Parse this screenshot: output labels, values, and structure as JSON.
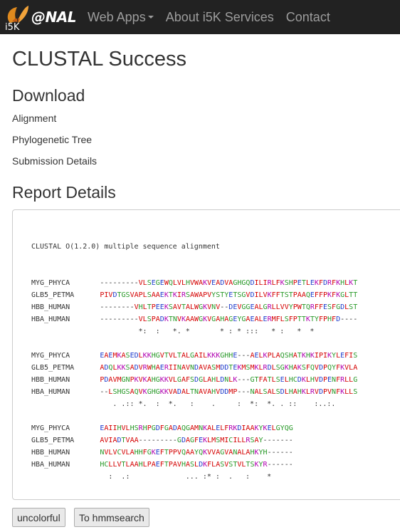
{
  "navbar": {
    "brand_prefix": "i5K",
    "brand_name": "@NAL",
    "items": [
      {
        "label": "Web Apps",
        "dropdown": true
      },
      {
        "label": "About i5K Services",
        "dropdown": false
      },
      {
        "label": "Contact",
        "dropdown": false
      }
    ]
  },
  "page": {
    "title": "CLUSTAL Success",
    "download_heading": "Download",
    "download_links": [
      "Alignment",
      "Phylogenetic Tree",
      "Submission Details"
    ],
    "report_heading": "Report Details"
  },
  "alignment": {
    "header": "CLUSTAL O(1.2.0) multiple sequence alignment",
    "blocks": [
      {
        "rows": [
          {
            "name": "MYG_PHYCA",
            "seq": "---------VLSEGEWQLVLHVWAKVEADVAGHGQDILIRLFKSHPETLEKFDRFKHLKT"
          },
          {
            "name": "GLB5_PETMA",
            "seq": "PIVDTGSVAPLSAAEKTKIRSAWAPVYSTYETSGVDILVKFFTSTPAAQEFFPKFKGLTT"
          },
          {
            "name": "HBB_HUMAN",
            "seq": "--------VHLTPEEKSAVTALWGKVNV--DEVGGEALGRLLVVYPWTQRFFESFGDLST"
          },
          {
            "name": "HBA_HUMAN",
            "seq": "---------VLSPADKTNVKAAWGKVGAHAGEYGAEALERMFLSFPTTKTYFPHFD----"
          }
        ],
        "consensus": "         *:  :   *. *       * : * :::   * :   *  *"
      },
      {
        "rows": [
          {
            "name": "MYG_PHYCA",
            "seq": "EAEMKASEDLKKHGVTVLTALGAILKKKGHHE---AELKPLAQSHATKHKIPIKYLEFIS"
          },
          {
            "name": "GLB5_PETMA",
            "seq": "ADQLKKSADVRWHAERIINAVNDAVASMDDTEKMSMKLRDLSGKHAKSFQVDPQYFKVLA"
          },
          {
            "name": "HBB_HUMAN",
            "seq": "PDAVMGNPKVKAHGKKVLGAFSDGLAHLDNLK---GTFATLSELHCDKLHVDPENFRLLG"
          },
          {
            "name": "HBA_HUMAN",
            "seq": "--LSHGSAQVKGHGKKVADALTNAVAHVDDMP---NALSALSDLHAHKLRVDPVNFKLLS"
          }
        ],
        "consensus": "   . .:: *.  :  *.   :    .     :  *:  *. . ::    :..:."
      },
      {
        "rows": [
          {
            "name": "MYG_PHYCA",
            "seq": "EAIIHVLHSRHPGDFGADAQGAMNKALELFRKDIAAKYKELGYQG"
          },
          {
            "name": "GLB5_PETMA",
            "seq": "AVIADTVAA---------GDAGFEKLMSMICILLRSAY-------"
          },
          {
            "name": "HBB_HUMAN",
            "seq": "NVLVCVLAHHFGKEFTPPVQAAYQKVVAGVANALAHKYH------"
          },
          {
            "name": "HBA_HUMAN",
            "seq": "HCLLVTLAAHLPAEFTPAVHASLDKFLASVSTVLTSKYR------"
          }
        ],
        "consensus": "  :  .:             ... :* :  .   :    *"
      }
    ]
  },
  "buttons": {
    "uncolorful": "uncolorful",
    "hmmsearch": "To hmmsearch"
  },
  "residue_colors": {
    "hydrophobic": "#d40000",
    "acidic": "#1f3dcc",
    "basic": "#b000b0",
    "polar": "#2a9a2a",
    "other": "#333333"
  }
}
